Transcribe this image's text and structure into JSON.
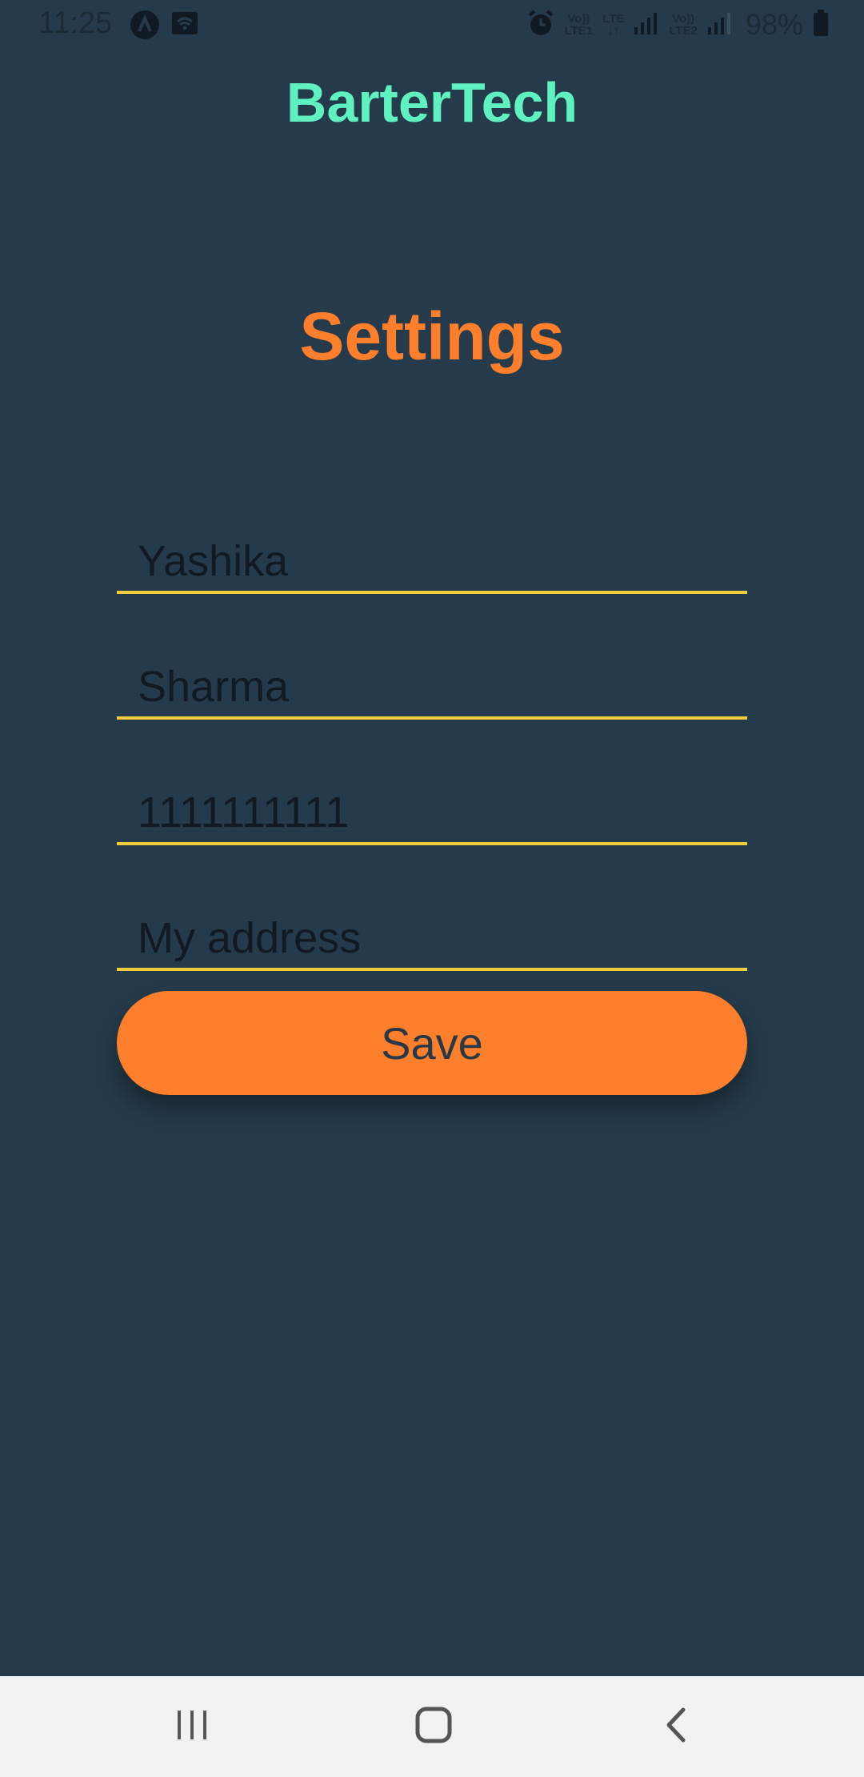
{
  "status_bar": {
    "time": "11:25",
    "lte1_top": "Vo))",
    "lte1_bottom": "LTE1",
    "lte_top": "LTE",
    "lte_bottom": "↓↑",
    "lte2_top": "Vo))",
    "lte2_bottom": "LTE2",
    "battery": "98%",
    "icons": [
      "app-a-icon",
      "wifi-icon",
      "alarm-icon",
      "signal-icon",
      "battery-icon"
    ]
  },
  "header": {
    "app_title": "BarterTech"
  },
  "main": {
    "page_title": "Settings",
    "fields": {
      "first_name": "Yashika",
      "last_name": "Sharma",
      "phone": "1111111111",
      "address": "My address"
    },
    "save_label": "Save"
  },
  "nav_bar": {
    "icons": [
      "recent-apps-icon",
      "home-icon",
      "back-icon"
    ]
  },
  "colors": {
    "background": "#253b4b",
    "app_title": "#5ff2c0",
    "accent": "#fd7f2c",
    "underline": "#f2cc3a",
    "nav_bar": "#f2f2f2"
  }
}
